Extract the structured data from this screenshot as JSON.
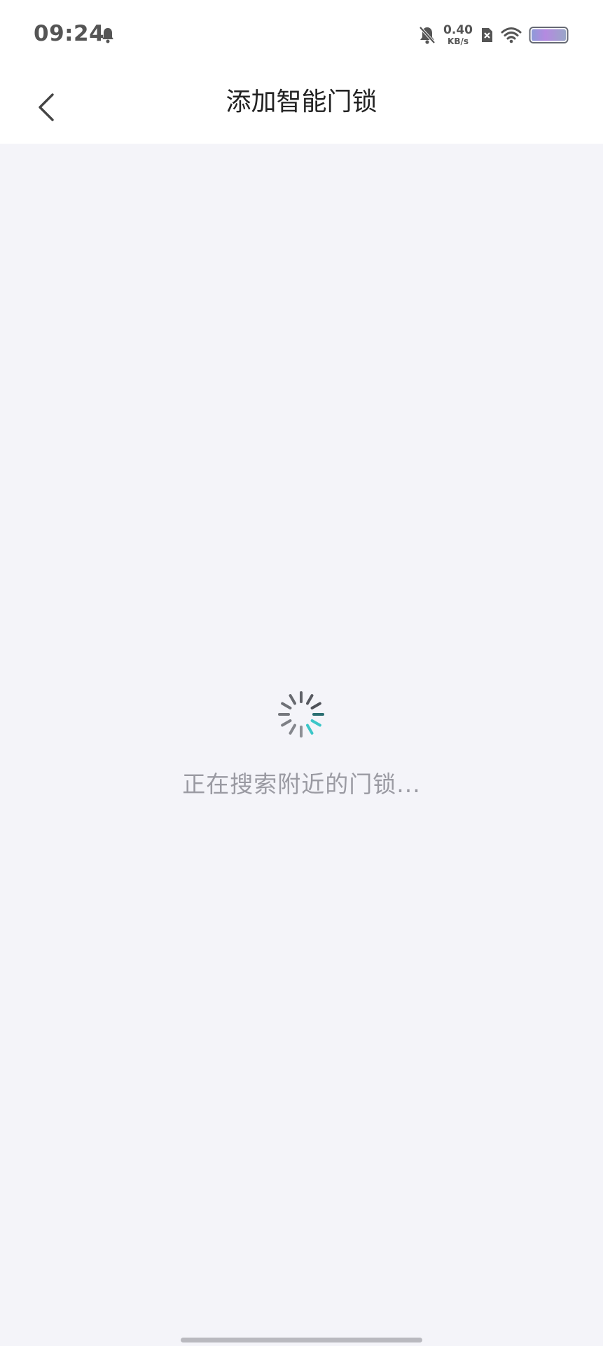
{
  "status_bar": {
    "time": "09:24",
    "net_speed_value": "0.40",
    "net_speed_unit": "KB/s",
    "icons": [
      "notification-bell-icon",
      "mute-icon",
      "sim-x-icon",
      "wifi-icon",
      "battery-icon"
    ]
  },
  "header": {
    "title": "添加智能门锁",
    "back_icon": "chevron-left-icon"
  },
  "main": {
    "loading_text": "正在搜索附近的门锁...",
    "spinner_icon": "loading-spinner-icon"
  },
  "colors": {
    "background": "#f4f4f9",
    "header_bg": "#ffffff",
    "spinner_accent": "#3cc6c8",
    "spinner_dark": "#3a3d44",
    "muted_text": "#9a9aa2"
  }
}
